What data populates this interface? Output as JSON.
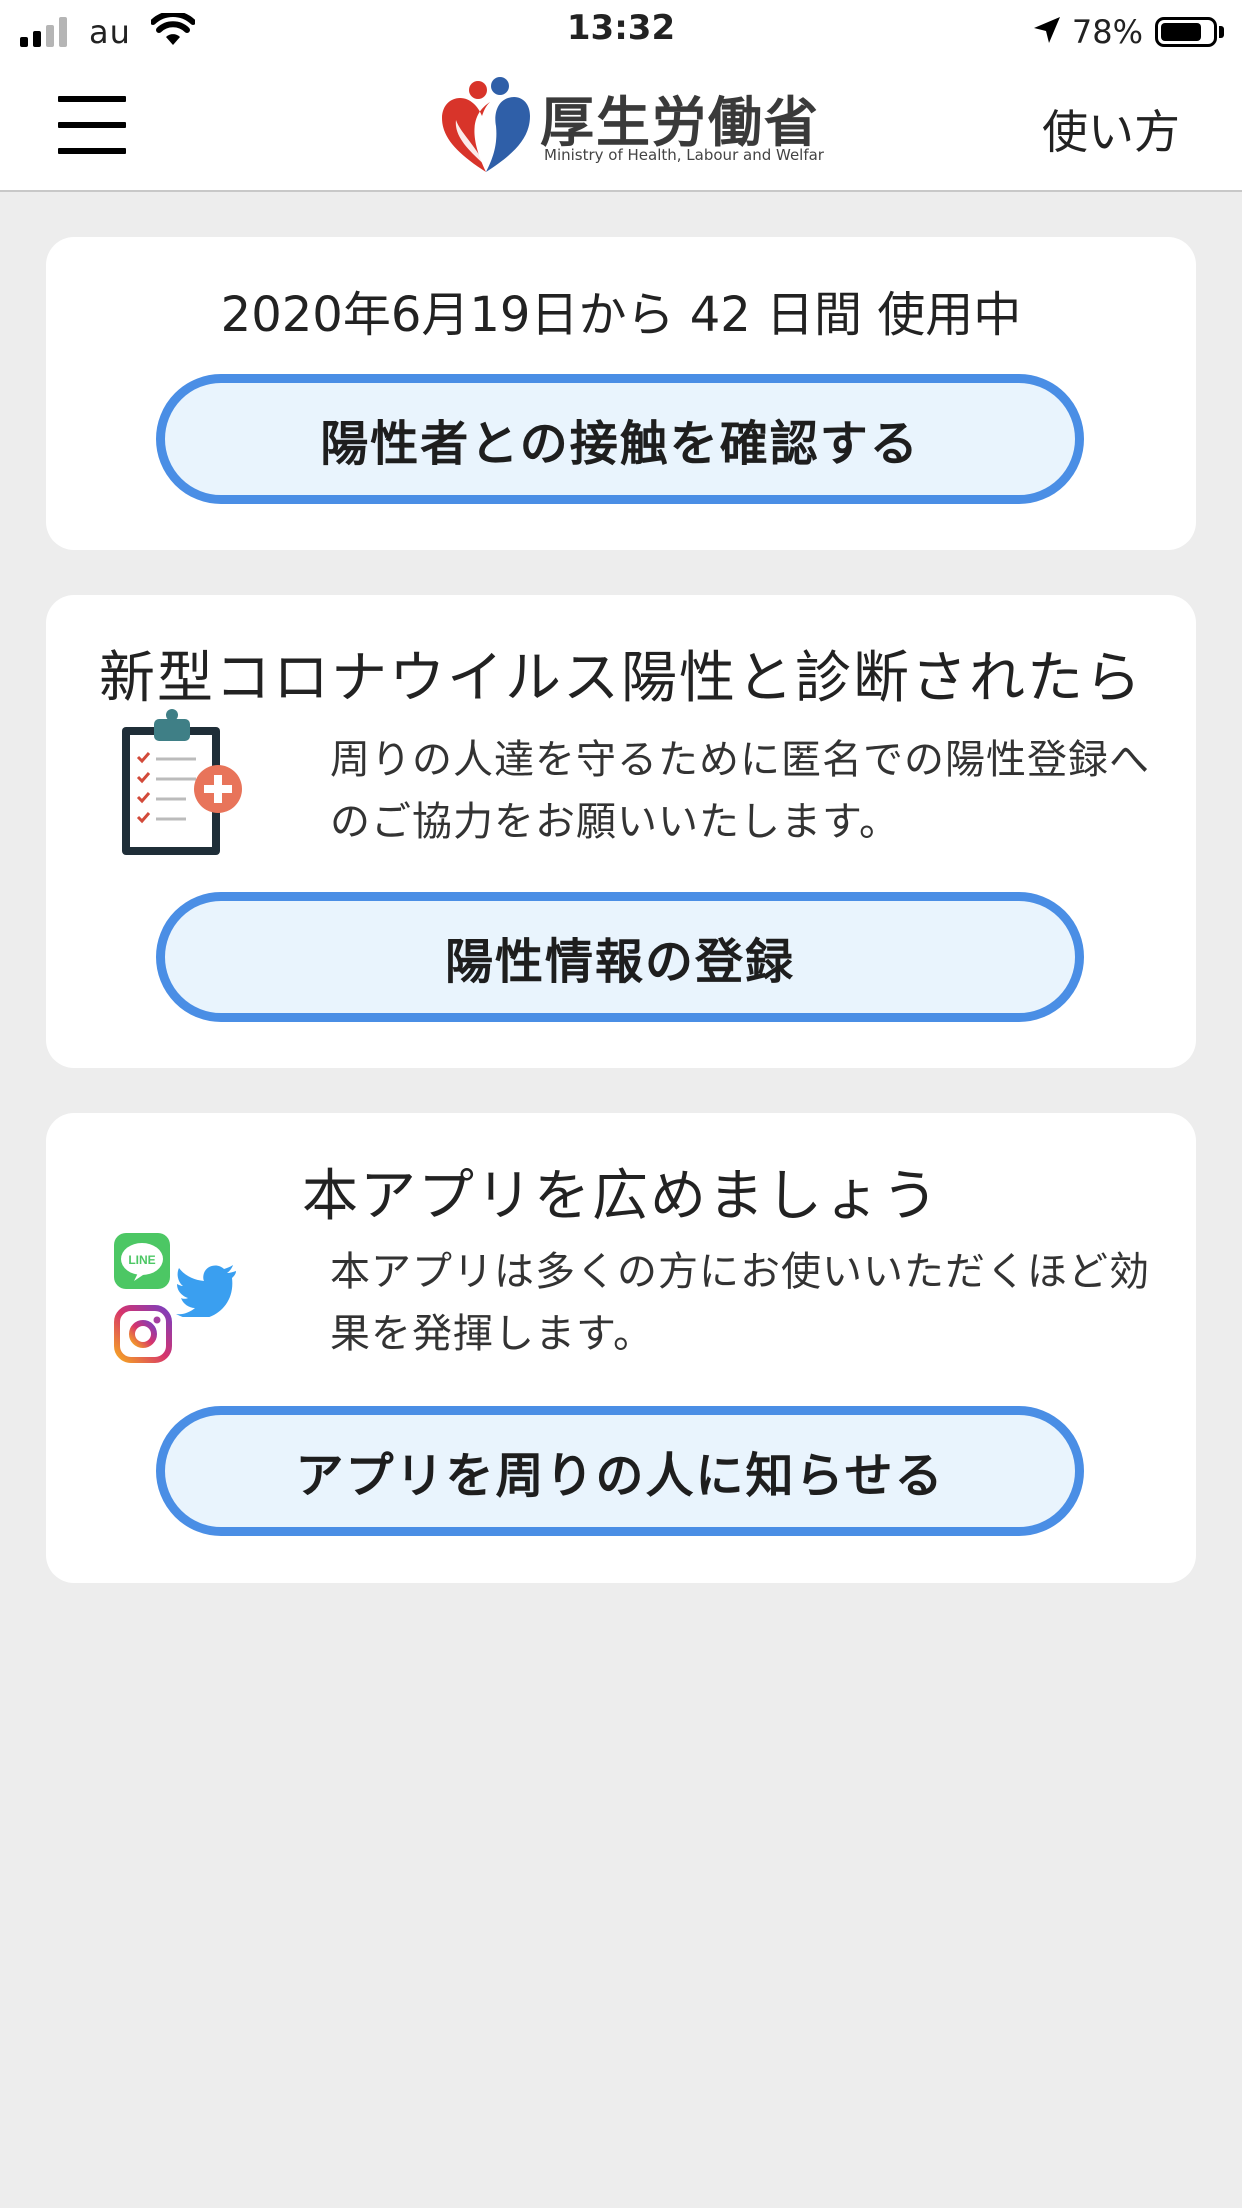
{
  "status_bar": {
    "carrier": "au",
    "time": "13:32",
    "battery_percent": "78%",
    "battery_level": 0.78,
    "signal_bars": 2
  },
  "header": {
    "logo_title": "厚生労働省",
    "logo_subtitle": "Ministry of Health, Labour and Welfar",
    "howto_label": "使い方",
    "menu_icon": "hamburger-menu-icon"
  },
  "usage_card": {
    "usage_text": "2020年6月19日から 42 日間 使用中",
    "check_button_label": "陽性者との接触を確認する"
  },
  "positive_card": {
    "title": "新型コロナウイルス陽性と診断されたら",
    "description": "周りの人達を守るために匿名での陽性登録へのご協力をお願いいたします。",
    "register_button_label": "陽性情報の登録",
    "icon": "medical-clipboard-icon"
  },
  "share_card": {
    "title": "本アプリを広めましょう",
    "description": "本アプリは多くの方にお使いいただくほど効果を発揮します。",
    "share_button_label": "アプリを周りの人に知らせる",
    "line_icon_text": "LINE",
    "icons": [
      "line-icon",
      "twitter-icon",
      "instagram-icon"
    ]
  },
  "colors": {
    "background": "#ededed",
    "card": "#ffffff",
    "button_border": "#4a8ee5",
    "button_fill": "#e9f4fd",
    "line_green": "#4cc764",
    "twitter_blue": "#3a9ff0"
  }
}
